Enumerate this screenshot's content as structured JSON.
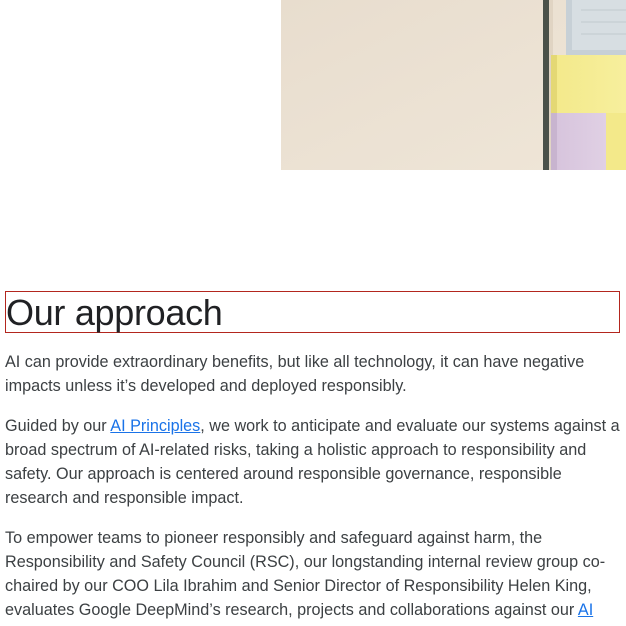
{
  "section": {
    "title": "Our approach",
    "paragraphs": {
      "p1": "AI can provide extraordinary benefits, but like all technology, it can have negative impacts unless it’s developed and deployed responsibly.",
      "p2_before": "Guided by our ",
      "p2_link": "AI Principles",
      "p2_after": ", we work to anticipate and evaluate our systems against a broad spectrum of AI-related risks, taking a holistic approach to responsibility and safety. Our approach is centered around responsible governance, responsible research and responsible impact.",
      "p3_before": "To empower teams to pioneer responsibly and safeguard against harm, the Responsibility and Safety Council (RSC), our longstanding internal review group co-chaired by our COO Lila Ibrahim and Senior Director of Responsibility Helen King, evaluates Google DeepMind’s research, projects and collaborations against our ",
      "p3_link": "AI"
    }
  },
  "colors": {
    "heading": "#202124",
    "body_text": "#3c4043",
    "link": "#1a73e8",
    "focus_outline": "#b3261e",
    "image_wall": "#ece2d3"
  }
}
